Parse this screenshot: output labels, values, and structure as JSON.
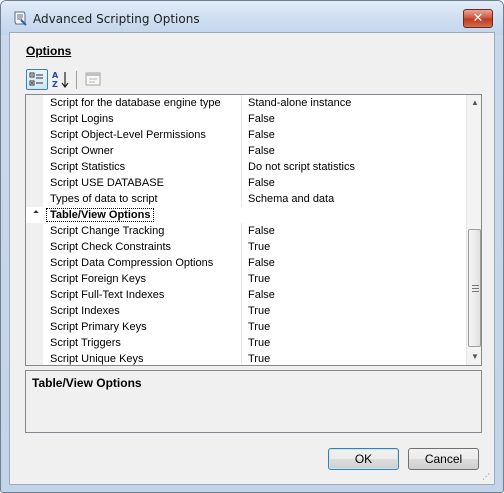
{
  "window": {
    "title": "Advanced Scripting Options",
    "close_glyph": "✕"
  },
  "options_label": "Options",
  "toolbar": {
    "categorized_icon": "categorized-icon",
    "alphabetical_icon": "sort-az-icon",
    "property_pages_icon": "property-pages-icon"
  },
  "grid": {
    "rows_top": [
      {
        "name": "Script for the database engine type",
        "value": "Stand-alone instance"
      },
      {
        "name": "Script Logins",
        "value": "False"
      },
      {
        "name": "Script Object-Level Permissions",
        "value": "False"
      },
      {
        "name": "Script Owner",
        "value": "False"
      },
      {
        "name": "Script Statistics",
        "value": "Do not script statistics"
      },
      {
        "name": "Script USE DATABASE",
        "value": "False"
      },
      {
        "name": "Types of data to script",
        "value": "Schema and data"
      }
    ],
    "category": "Table/View Options",
    "rows_bottom": [
      {
        "name": "Script Change Tracking",
        "value": "False"
      },
      {
        "name": "Script Check Constraints",
        "value": "True"
      },
      {
        "name": "Script Data Compression Options",
        "value": "False"
      },
      {
        "name": "Script Foreign Keys",
        "value": "True"
      },
      {
        "name": "Script Full-Text Indexes",
        "value": "False"
      },
      {
        "name": "Script Indexes",
        "value": "True"
      },
      {
        "name": "Script Primary Keys",
        "value": "True"
      },
      {
        "name": "Script Triggers",
        "value": "True"
      },
      {
        "name": "Script Unique Keys",
        "value": "True"
      }
    ]
  },
  "description": {
    "title": "Table/View Options"
  },
  "buttons": {
    "ok": "OK",
    "cancel": "Cancel"
  }
}
